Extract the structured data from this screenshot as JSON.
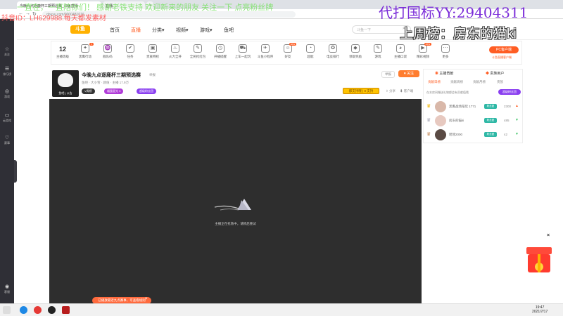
{
  "browser": {
    "tabs": [
      {
        "label": "今晚九点逐鹿杯三期预选赛_斗鱼直播",
        "active": true
      },
      {
        "label": "直播",
        "active": false
      }
    ],
    "new_tab": "+",
    "url": "douyu.com/9000481016"
  },
  "overlay": {
    "top_scroll": "一直在，一直陪你们！ 感谢老铁支持 欢迎新来的朋友 关注一下 点亮粉丝牌",
    "watermark_id": "抖音ID：LH629988.每天都发素材",
    "yy": "代打国标YY:29404311",
    "rank_label": "上周榜：房东的猫ki"
  },
  "leftbar": {
    "items": [
      {
        "icon": "☆",
        "label": "关注"
      },
      {
        "icon": "☰",
        "label": "排行榜"
      },
      {
        "icon": "◎",
        "label": "游戏"
      },
      {
        "icon": "▭",
        "label": "云游戏"
      },
      {
        "icon": "♡",
        "label": "赛事"
      }
    ],
    "bottom": {
      "icon": "◉",
      "label": "客服"
    }
  },
  "header": {
    "logo": "斗鱼",
    "nav": [
      {
        "label": "首页",
        "active": false
      },
      {
        "label": "直播",
        "active": true
      },
      {
        "label": "分类▾",
        "active": false
      },
      {
        "label": "视频▾",
        "active": false
      },
      {
        "label": "游戏▾",
        "active": false
      },
      {
        "label": "鱼吧",
        "active": false
      }
    ],
    "search_placeholder": "斗鱼一下"
  },
  "catbar": {
    "level": "12",
    "level_label": "主播等级",
    "items": [
      {
        "label": "黑鹰行动",
        "icon": "✦",
        "badge": "1"
      },
      {
        "label": "舰队码",
        "icon": "♒",
        "badge": ""
      },
      {
        "label": "任务",
        "icon": "✔",
        "badge": ""
      },
      {
        "label": "贵族特权",
        "icon": "▣",
        "badge": ""
      },
      {
        "label": "火力全开",
        "icon": "♨",
        "badge": ""
      },
      {
        "label": "全民抢红包",
        "icon": "✎",
        "badge": ""
      },
      {
        "label": "开播提醒",
        "icon": "◷",
        "badge": ""
      },
      {
        "label": "上车一起玩",
        "icon": "⛟",
        "badge": ""
      },
      {
        "label": "斗鱼小程序",
        "icon": "✈",
        "badge": ""
      },
      {
        "label": "好友",
        "icon": "☺",
        "badge": "new"
      },
      {
        "label": "超能",
        "icon": "◔",
        "badge": ""
      },
      {
        "label": "电竞排行",
        "icon": "✪",
        "badge": ""
      },
      {
        "label": "领取奖励",
        "icon": "◆",
        "badge": ""
      },
      {
        "label": "游戏",
        "icon": "✎",
        "badge": ""
      },
      {
        "label": "主播口袋",
        "icon": "◕",
        "badge": ""
      },
      {
        "label": "精彩视频",
        "icon": "▶",
        "badge": "new"
      },
      {
        "label": "更多",
        "icon": "⋯",
        "badge": ""
      }
    ],
    "pc_button": "PC客户端",
    "pc_sub": "斗鱼直播客户端"
  },
  "room": {
    "title": "今晚九点逐鹿杯三期预选赛",
    "tag": "举报",
    "meta": "鱼吧  · 大小雪  · 颜值  · 主播 17.9万",
    "avatar_level": "鱼吧 | 公告",
    "pills": [
      {
        "label": "V周榜",
        "color": "#333333"
      },
      {
        "label": "福蛋星光 3",
        "color": "#b03cd8"
      },
      {
        "label": "超级粉丝团",
        "color": "#8a3ff0"
      }
    ],
    "report": "举报",
    "follow": "♥ 关注",
    "bar": "都支持哦 | 0 支持",
    "share": "⇪ 分享",
    "download": "⬇ 客户端"
  },
  "player": {
    "message": "主播正在抢救中，请稍后重试"
  },
  "toast": {
    "text": "已播放最近九点赛事，可查看规则",
    "close": "×"
  },
  "rank": {
    "tabs": [
      {
        "icon": "◉",
        "label": "主播贡献"
      },
      {
        "icon": "◆",
        "label": "贵族用户"
      }
    ],
    "subtabs": [
      {
        "label": "贡献日榜",
        "active": true
      },
      {
        "label": "贡献周榜",
        "active": false
      },
      {
        "label": "贡献月榜",
        "active": false
      },
      {
        "label": "贵族",
        "active": false
      }
    ],
    "note": "在本房间赠送礼物都会有贡献值哦",
    "contrib_button": "超级粉丝团",
    "rows": [
      {
        "name": "黑鹰战场陪玩 1771",
        "tag": "粉丝团",
        "value": "2300",
        "trend": "▲",
        "up": true
      },
      {
        "name": "房东的猫ki",
        "tag": "粉丝团",
        "value": "485",
        "trend": "▼",
        "up": false
      },
      {
        "name": "瑶瑶2000",
        "tag": "粉丝团",
        "value": "42",
        "trend": "▼",
        "up": false
      }
    ]
  },
  "misc": {
    "close_x": "×"
  },
  "taskbar": {
    "time": "19:47",
    "date": "2021/7/17"
  }
}
